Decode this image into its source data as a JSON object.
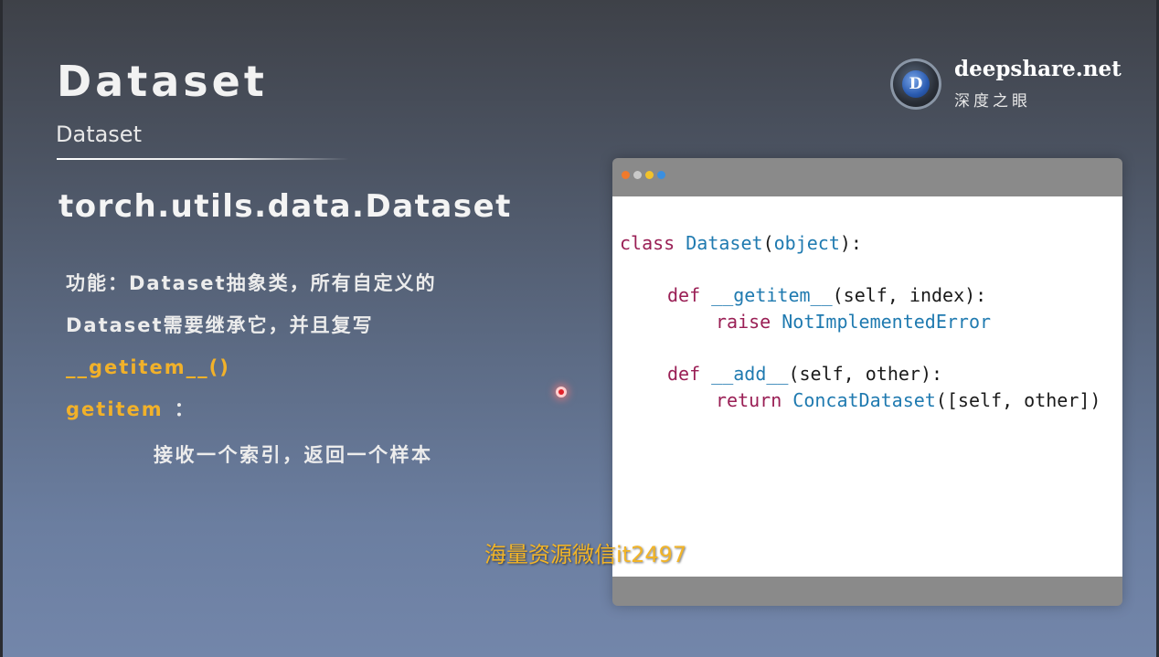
{
  "slide": {
    "title": "Dataset",
    "subtitle": "Dataset",
    "section_heading": "torch.utils.data.Dataset"
  },
  "description": {
    "line1": "功能：Dataset抽象类，所有自定义的",
    "line2": "Dataset需要继承它，并且复写",
    "method_highlight": "__getitem__()",
    "getitem_label": "getitem",
    "getitem_sep": "：",
    "getitem_desc": "接收一个索引，返回一个样本"
  },
  "logo": {
    "name": "deepshare.net",
    "chinese_name": "深度之眼",
    "mark_letter": "D"
  },
  "code": {
    "line1": {
      "kw": "class",
      "name": "Dataset",
      "rest": "(",
      "base": "object",
      "end": "):"
    },
    "line2": {
      "kw": "def",
      "name": "__getitem__",
      "rest": "(self, index):"
    },
    "line3": {
      "kw": "raise",
      "name": "NotImplementedError"
    },
    "line4": {
      "kw": "def",
      "name": "__add__",
      "rest": "(self, other):"
    },
    "line5": {
      "kw": "return",
      "name": "ConcatDataset",
      "rest": "([self, other])"
    }
  },
  "window_dots": [
    "#f07a2c",
    "#c9c9c9",
    "#f2c22b",
    "#3b8fe0"
  ],
  "watermark": "海量资源微信it2497",
  "colors": {
    "accent": "#f1b12a",
    "code_keyword": "#9a1f55",
    "code_name": "#1f7ab0"
  }
}
